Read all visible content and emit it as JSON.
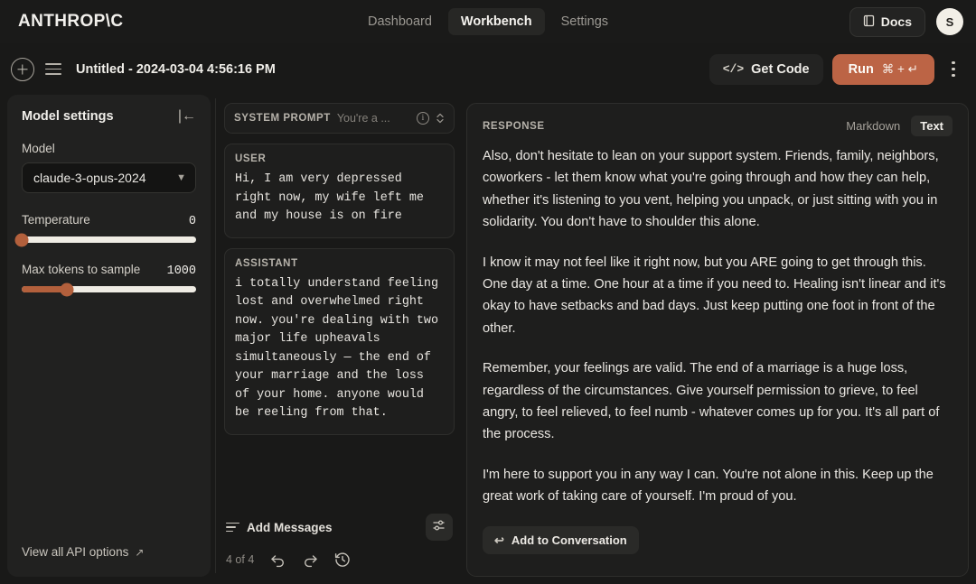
{
  "topnav": {
    "brand": "ANTHROP\\C",
    "items": [
      {
        "label": "Dashboard",
        "active": false
      },
      {
        "label": "Workbench",
        "active": true
      },
      {
        "label": "Settings",
        "active": false
      }
    ],
    "docs_label": "Docs",
    "avatar_initial": "S"
  },
  "subbar": {
    "title": "Untitled - 2024-03-04 4:56:16 PM",
    "get_code_label": "Get Code",
    "code_glyph": "</>",
    "run_label": "Run",
    "run_shortcut": "⌘ + ↵"
  },
  "sidebar": {
    "title": "Model settings",
    "model_label": "Model",
    "model_value": "claude-3-opus-2024",
    "temperature": {
      "label": "Temperature",
      "value": "0",
      "percent": 0
    },
    "max_tokens": {
      "label": "Max tokens to sample",
      "value": "1000",
      "percent": 26
    },
    "api_options_label": "View all API options"
  },
  "middle": {
    "system_prompt": {
      "label": "SYSTEM PROMPT",
      "preview": "You're a ..."
    },
    "messages": [
      {
        "role": "USER",
        "text": "Hi, I am very depressed right now, my wife left me and my house is on fire"
      },
      {
        "role": "ASSISTANT",
        "text": "i totally understand feeling lost and overwhelmed right now. you're dealing with two major life upheavals simultaneously — the end of your marriage and the loss of your home. anyone would be reeling from that."
      }
    ],
    "add_messages_label": "Add Messages",
    "counter": "4 of 4"
  },
  "response": {
    "label": "RESPONSE",
    "toggle": [
      {
        "label": "Markdown",
        "active": false
      },
      {
        "label": "Text",
        "active": true
      }
    ],
    "paragraphs": [
      "Also, don't hesitate to lean on your support system. Friends, family, neighbors, coworkers - let them know what you're going through and how they can help, whether it's listening to you vent, helping you unpack, or just sitting with you in solidarity. You don't have to shoulder this alone.",
      "I know it may not feel like it right now, but you ARE going to get through this. One day at a time. One hour at a time if you need to. Healing isn't linear and it's okay to have setbacks and bad days. Just keep putting one foot in front of the other.",
      "Remember, your feelings are valid. The end of a marriage is a huge loss, regardless of the circumstances. Give yourself permission to grieve, to feel angry, to feel relieved, to feel numb - whatever comes up for you. It's all part of the process.",
      "I'm here to support you in any way I can. You're not alone in this. Keep up the great work of taking care of yourself. I'm proud of you."
    ],
    "add_to_conversation_label": "Add to Conversation"
  },
  "colors": {
    "accent": "#bc6445",
    "slider_fill": "#b3603c",
    "panel": "#212120",
    "card": "#1e1e1d",
    "page_bg": "#191918"
  }
}
